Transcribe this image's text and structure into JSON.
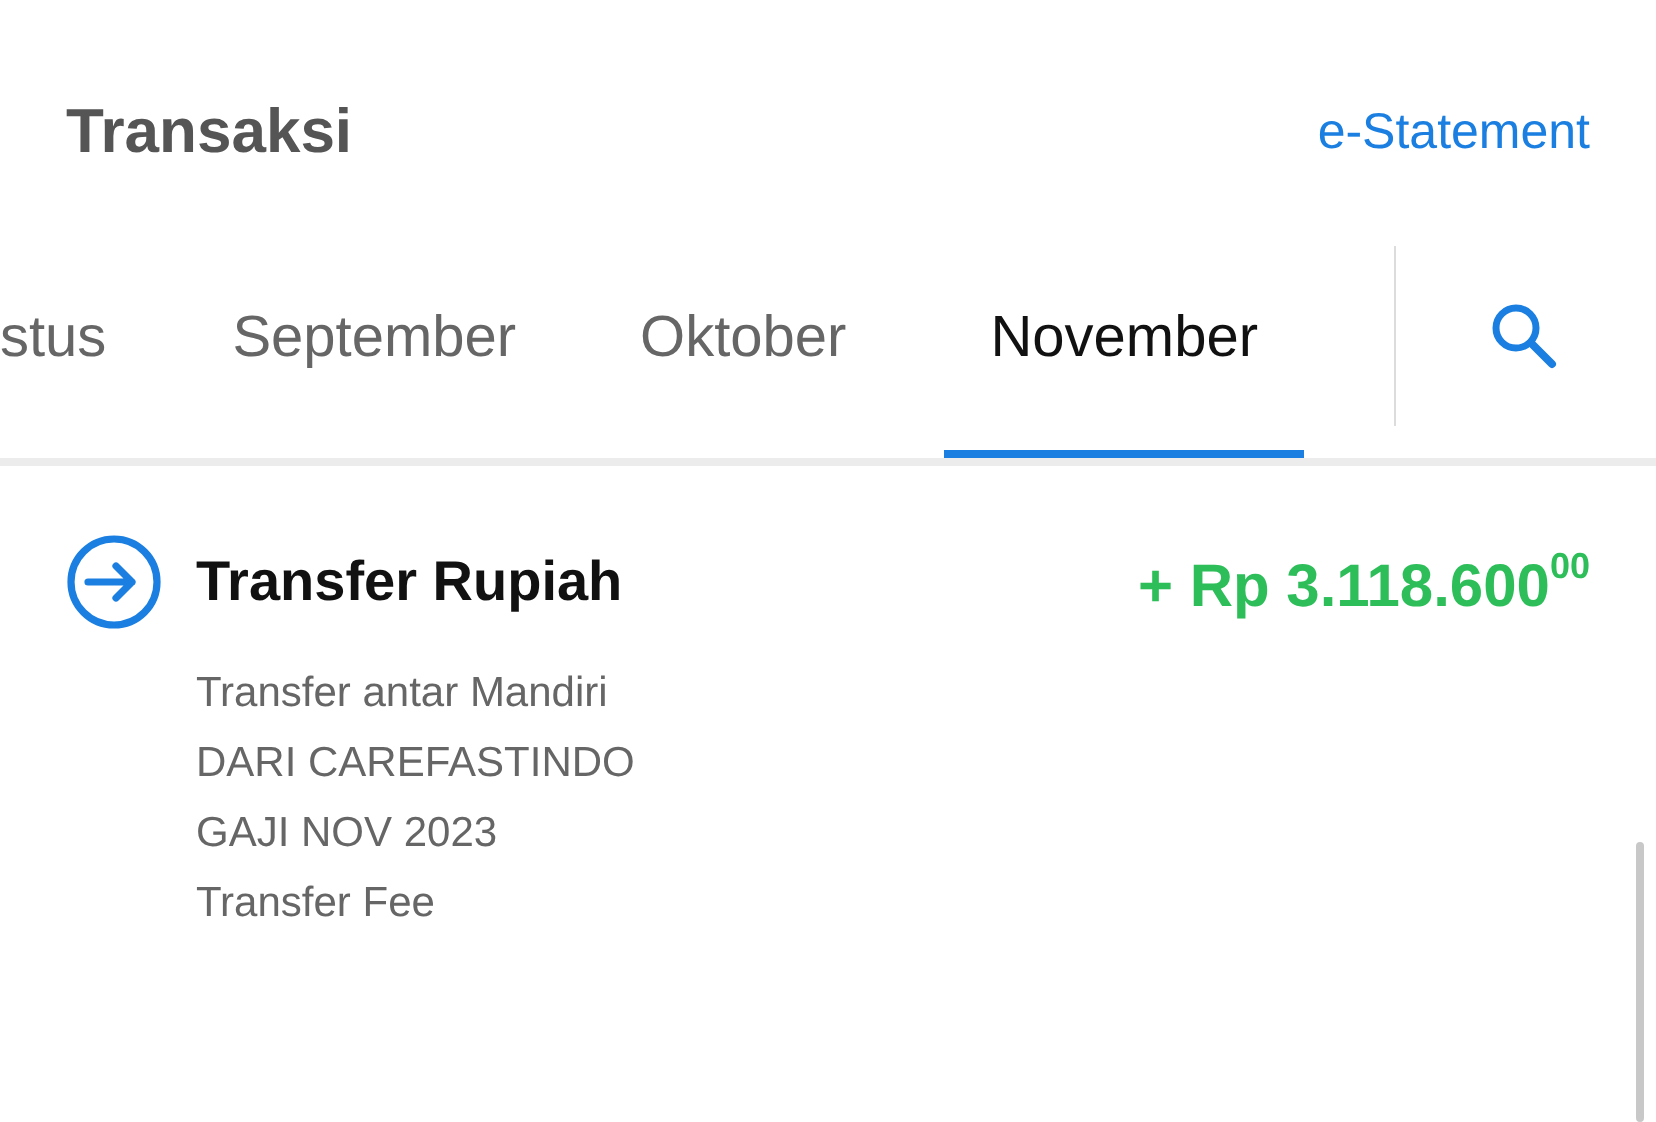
{
  "header": {
    "title": "Transaksi",
    "link": "e-Statement"
  },
  "tabs": [
    {
      "label": "stus",
      "selected": false
    },
    {
      "label": "September",
      "selected": false
    },
    {
      "label": "Oktober",
      "selected": false
    },
    {
      "label": "November",
      "selected": true
    }
  ],
  "transactions": [
    {
      "kind": "incoming",
      "title": "Transfer Rupiah",
      "amount": "+ Rp 3.118.600$^{00}$",
      "details": [
        "Transfer antar Mandiri",
        "DARI CAREFASTINDO",
        "GAJI NOV 2023",
        "Transfer Fee"
      ]
    }
  ]
}
